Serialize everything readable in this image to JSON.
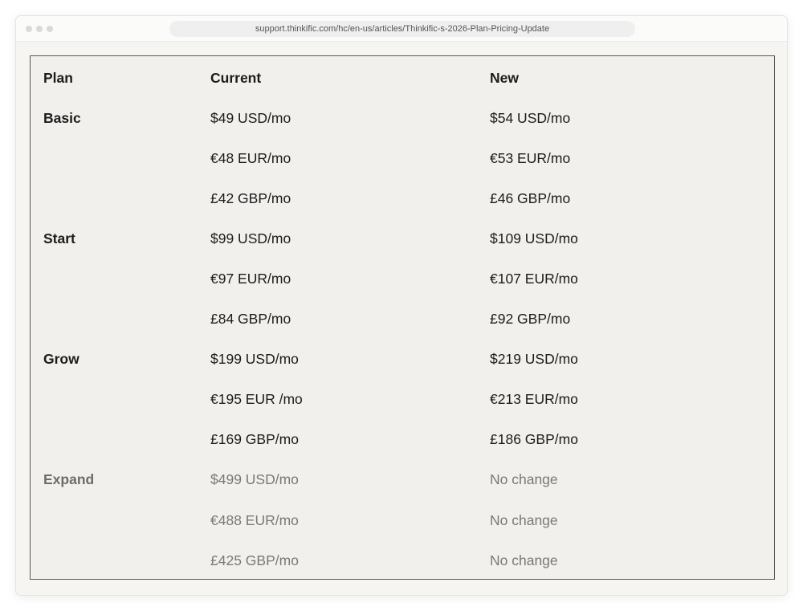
{
  "browser": {
    "url": "support.thinkific.com/hc/en-us/articles/Thinkific-s-2026-Plan-Pricing-Update"
  },
  "table": {
    "headers": [
      "Plan",
      "Current",
      "New"
    ],
    "rows": [
      [
        "Basic",
        "$49 USD/mo",
        "$54 USD/mo"
      ],
      [
        "",
        "€48 EUR/mo",
        "€53 EUR/mo"
      ],
      [
        "",
        "£42 GBP/mo",
        "£46 GBP/mo"
      ],
      [
        "Start",
        "$99 USD/mo",
        "$109 USD/mo"
      ],
      [
        "",
        "€97 EUR/mo",
        "€107 EUR/mo"
      ],
      [
        "",
        "£84 GBP/mo",
        "£92 GBP/mo"
      ],
      [
        "Grow",
        "$199 USD/mo",
        "$219 USD/mo"
      ],
      [
        "",
        "€195 EUR /mo",
        "€213 EUR/mo"
      ],
      [
        "",
        "£169 GBP/mo",
        "£186 GBP/mo"
      ],
      [
        "Expand",
        "$499 USD/mo",
        "No change"
      ],
      [
        "",
        "€488 EUR/mo",
        "No change"
      ],
      [
        "",
        "£425 GBP/mo",
        "No change"
      ]
    ]
  }
}
